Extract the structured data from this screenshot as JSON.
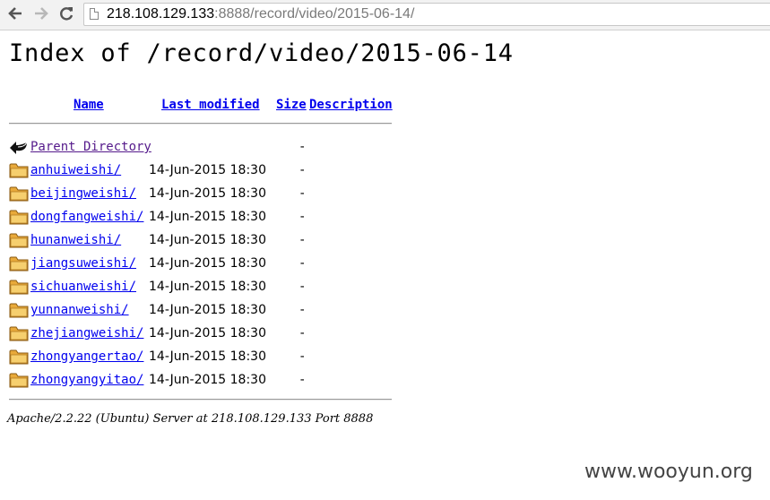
{
  "browser": {
    "back_icon": "arrow-left-icon",
    "forward_icon": "arrow-right-icon",
    "reload_icon": "reload-icon",
    "url_host": "218.108.129.133",
    "url_rest": ":8888/record/video/2015-06-14/"
  },
  "page": {
    "title": "Index of /record/video/2015-06-14",
    "columns": {
      "name": "Name",
      "last_modified": "Last modified",
      "size": "Size",
      "description": "Description"
    },
    "parent": {
      "label": "Parent Directory",
      "size": "-",
      "icon": "back-arrow-icon"
    },
    "entries": [
      {
        "name": "anhuiweishi/",
        "modified": "14-Jun-2015 18:30",
        "size": "-"
      },
      {
        "name": "beijingweishi/",
        "modified": "14-Jun-2015 18:30",
        "size": "-"
      },
      {
        "name": "dongfangweishi/",
        "modified": "14-Jun-2015 18:30",
        "size": "-"
      },
      {
        "name": "hunanweishi/",
        "modified": "14-Jun-2015 18:30",
        "size": "-"
      },
      {
        "name": "jiangsuweishi/",
        "modified": "14-Jun-2015 18:30",
        "size": "-"
      },
      {
        "name": "sichuanweishi/",
        "modified": "14-Jun-2015 18:30",
        "size": "-"
      },
      {
        "name": "yunnanweishi/",
        "modified": "14-Jun-2015 18:30",
        "size": "-"
      },
      {
        "name": "zhejiangweishi/",
        "modified": "14-Jun-2015 18:30",
        "size": "-"
      },
      {
        "name": "zhongyangertao/",
        "modified": "14-Jun-2015 18:30",
        "size": "-"
      },
      {
        "name": "zhongyangyitao/",
        "modified": "14-Jun-2015 18:30",
        "size": "-"
      }
    ],
    "entry_icon": "folder-icon",
    "address": "Apache/2.2.22 (Ubuntu) Server at 218.108.129.133 Port 8888"
  },
  "watermark": "www.wooyun.org",
  "colors": {
    "link": "#0000ee",
    "visited": "#551a8b",
    "folder": "#f0c060"
  }
}
